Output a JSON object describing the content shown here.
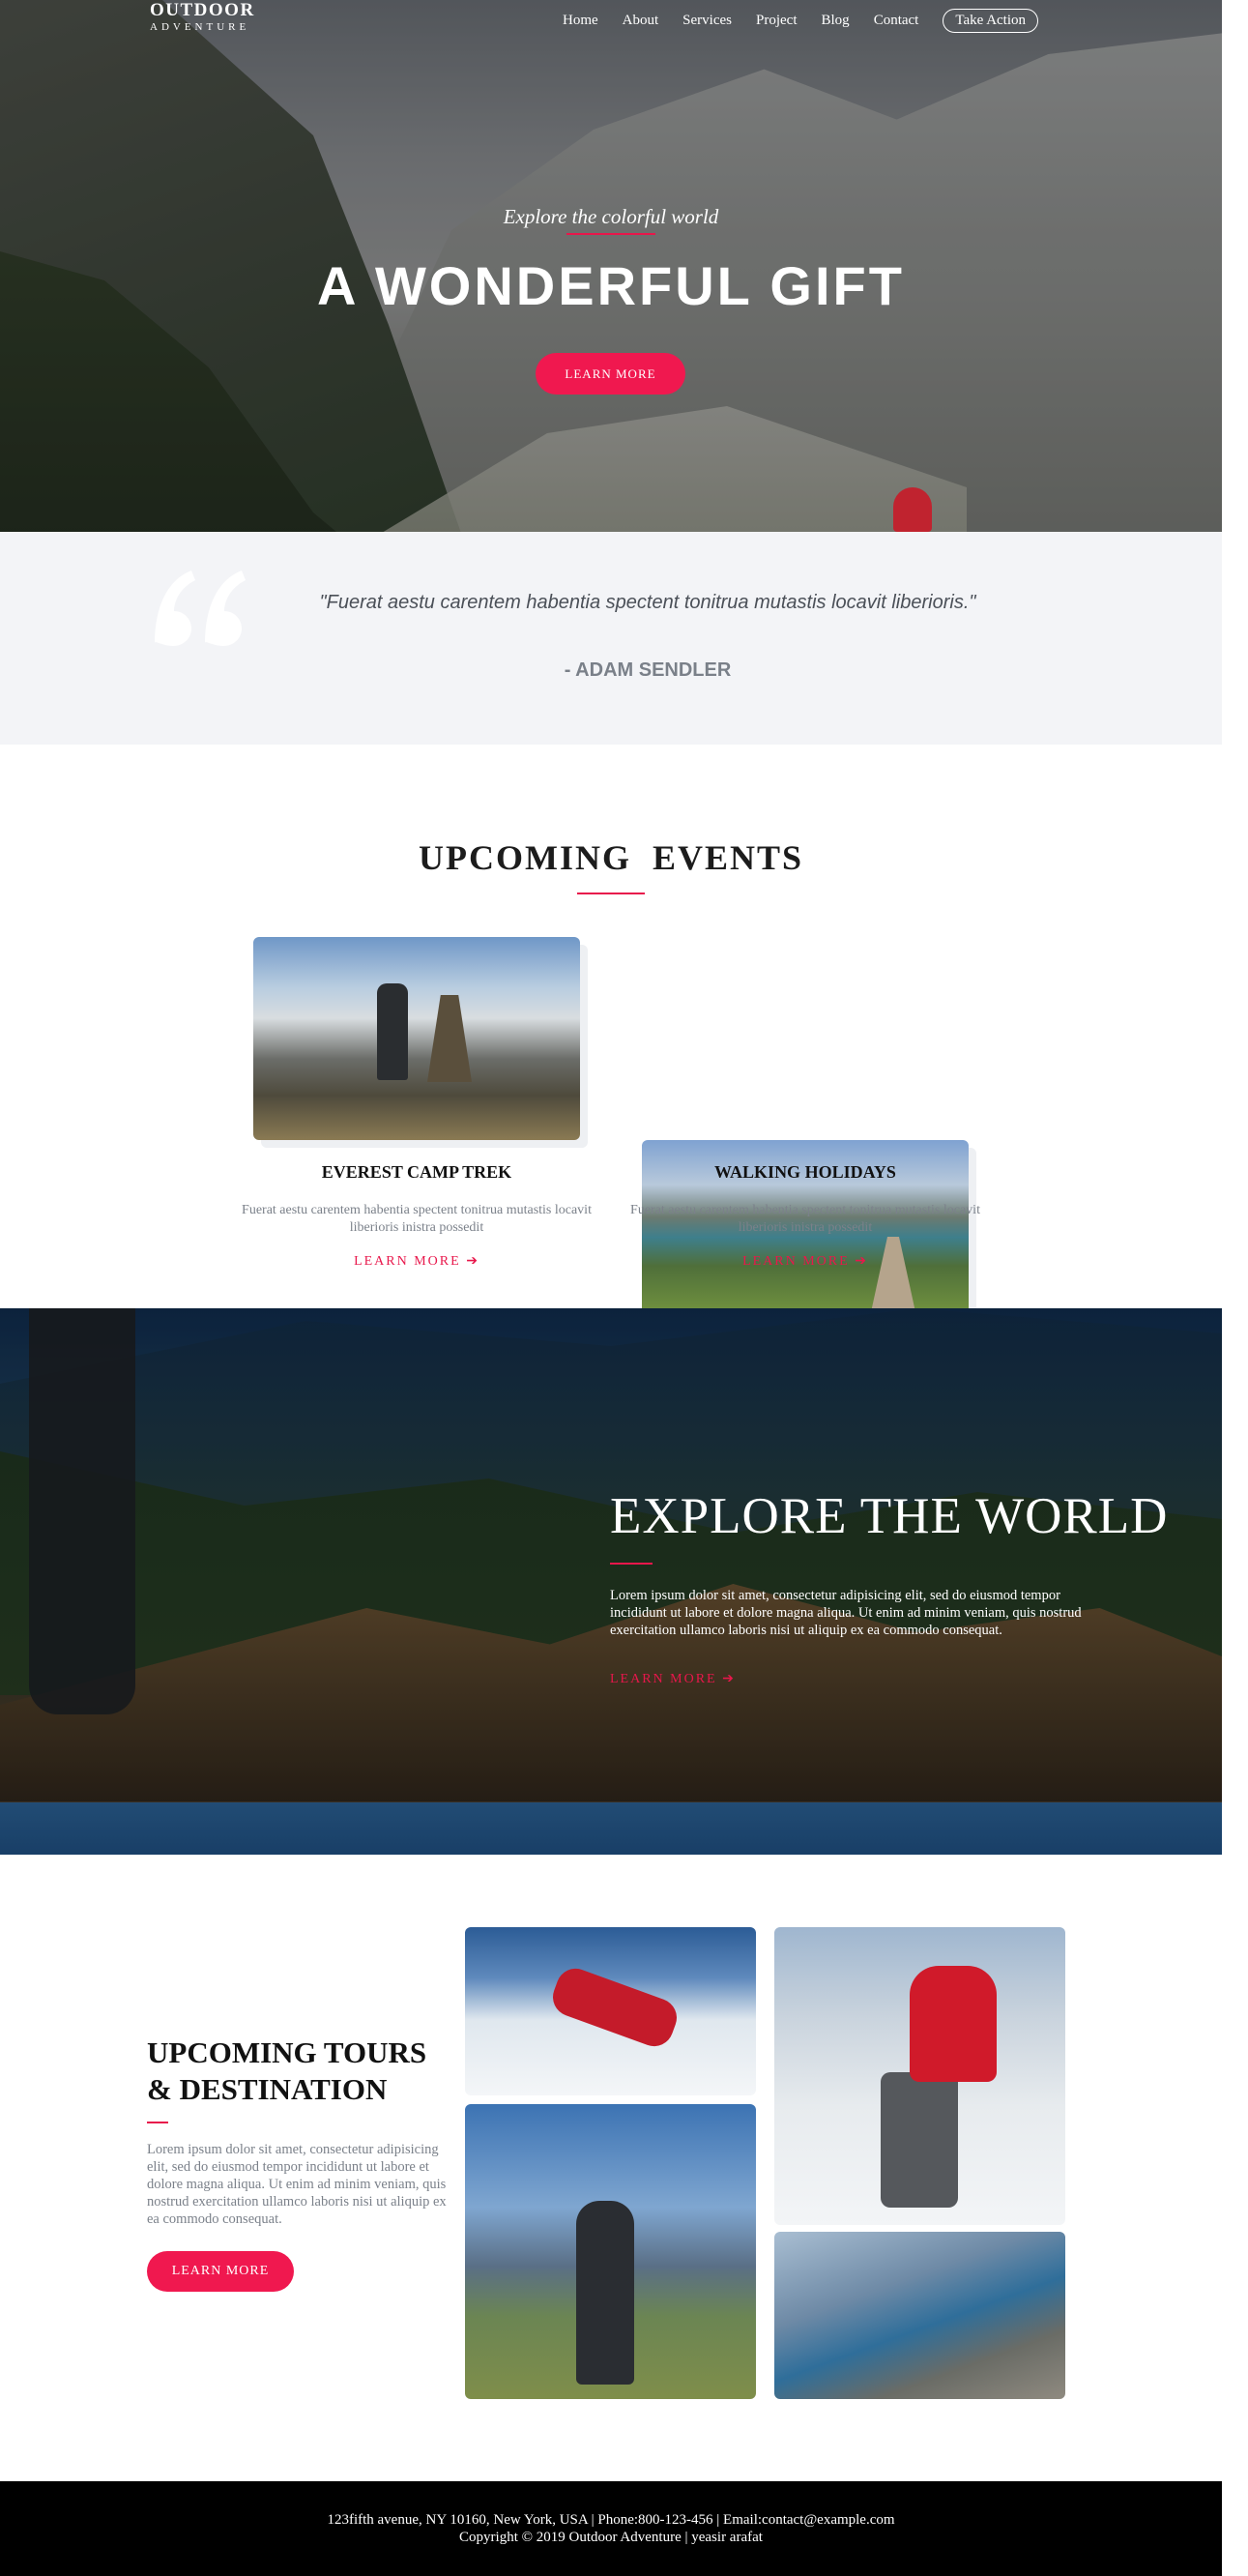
{
  "brand": {
    "name": "OUTDOOR",
    "tagline": "ADVENTURE"
  },
  "nav": {
    "items": [
      "Home",
      "About",
      "Services",
      "Project",
      "Blog",
      "Contact"
    ],
    "cta": "Take Action"
  },
  "hero": {
    "subtitle": "Explore the colorful world",
    "title": "A WONDERFUL GIFT",
    "button": "LEARN MORE"
  },
  "quote": {
    "text": "\"Fuerat aestu carentem habentia spectent tonitrua mutastis locavit liberioris.\"",
    "author": "- ADAM SENDLER",
    "icon": "quote-icon"
  },
  "events": {
    "title": "UPCOMING  EVENTS",
    "cards": [
      {
        "title": "EVEREST CAMP TREK",
        "desc": "Fuerat aestu carentem habentia spectent tonitrua mutastis locavit liberioris inistra possedit",
        "link": "LEARN MORE"
      },
      {
        "title": "WALKING HOLIDAYS",
        "desc": "Fuerat aestu carentem habentia spectent tonitrua mutastis locavit liberioris inistra possedit",
        "link": "LEARN MORE"
      }
    ]
  },
  "explore": {
    "title": "EXPLORE THE WORLD",
    "text": "Lorem ipsum dolor sit amet, consectetur adipisicing elit, sed do eiusmod tempor incididunt ut labore et dolore magna aliqua. Ut enim ad minim veniam, quis nostrud exercitation ullamco laboris nisi ut aliquip ex ea commodo consequat.",
    "link": "LEARN MORE"
  },
  "tours": {
    "title": "UPCOMING TOURS & DESTINATION",
    "text": "Lorem ipsum dolor sit amet, consectetur adipisicing elit, sed do eiusmod tempor incididunt ut labore et dolore magna aliqua. Ut enim ad minim veniam, quis nostrud exercitation ullamco laboris nisi ut aliquip ex ea commodo consequat.",
    "button": "LEARN MORE"
  },
  "footer": {
    "line1": "123fifth avenue, NY 10160, New York, USA | Phone:800-123-456 | Email:contact@example.com",
    "line2": "Copyright © 2019 Outdoor Adventure | yeasir arafat"
  },
  "colors": {
    "accent": "#f0184f",
    "quote_bg": "#f3f4f7",
    "footer_bg": "#000000"
  }
}
